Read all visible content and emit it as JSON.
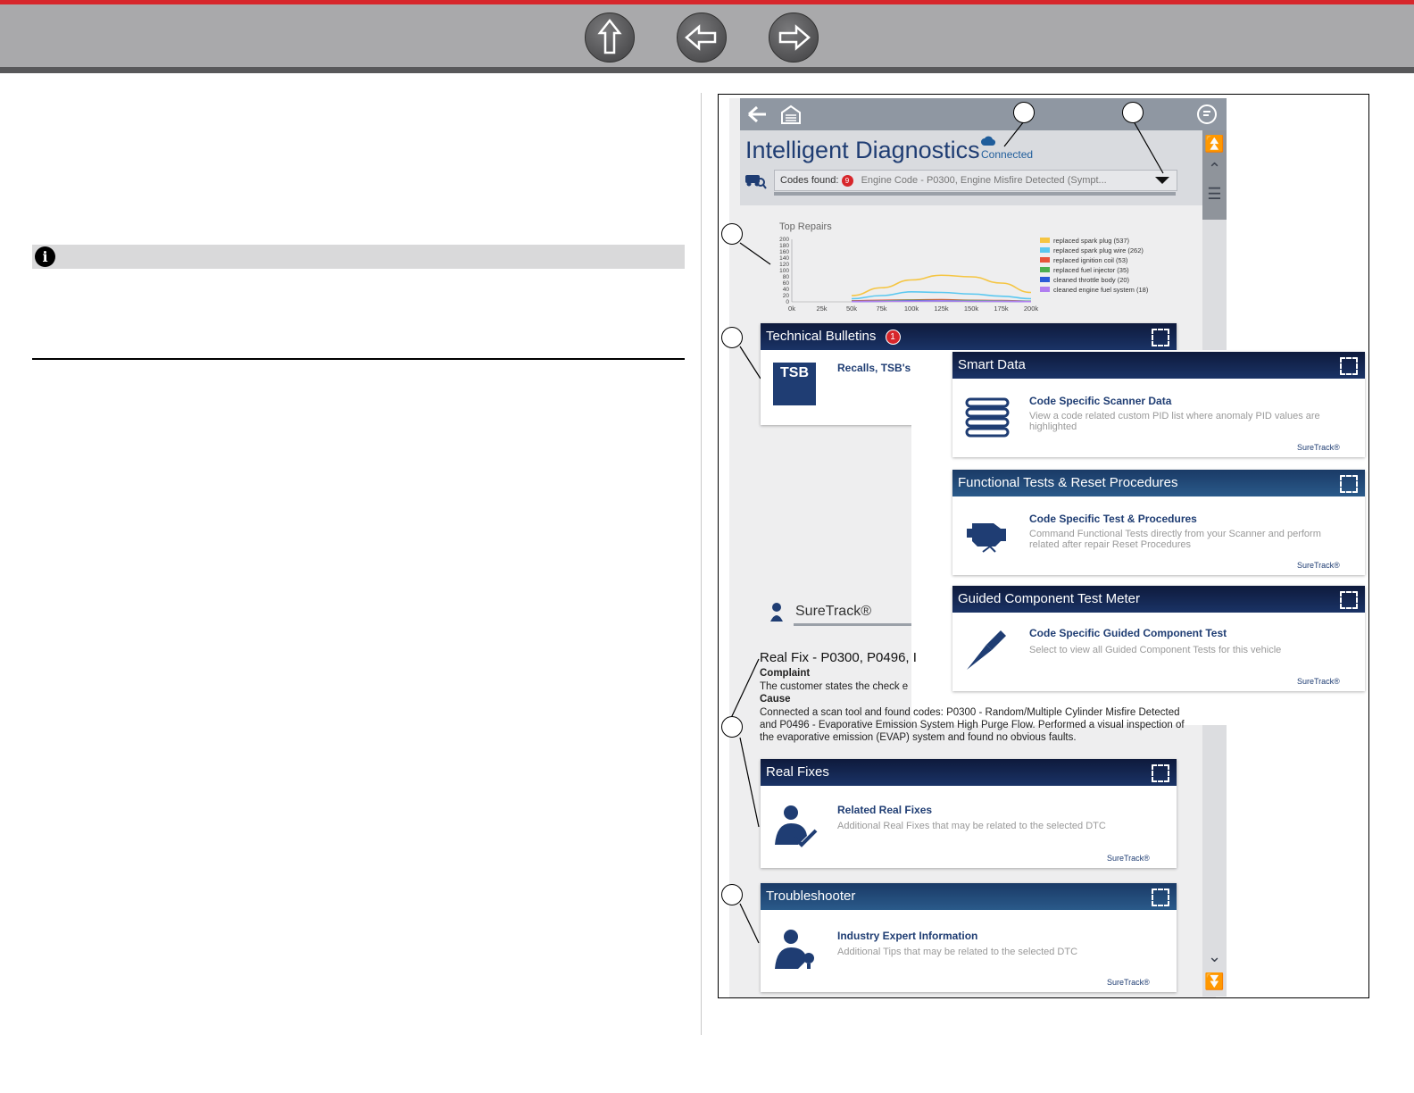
{
  "figure": {
    "app": {
      "title": "Intelligent Diagnostics",
      "connection_status": "Connected",
      "codes_found_label": "Codes found:",
      "codes_found_count": "9",
      "selected_code": "Engine Code - P0300, Engine Misfire Detected (Sympt..."
    },
    "top_repairs": {
      "title": "Top Repairs",
      "chart_data": {
        "type": "line",
        "title": "Top Repairs",
        "x": [
          "0k",
          "25k",
          "50k",
          "75k",
          "100k",
          "125k",
          "150k",
          "175k",
          "200k"
        ],
        "ylim": [
          0,
          200
        ],
        "y_ticks": [
          "200",
          "180",
          "160",
          "140",
          "120",
          "100",
          "80",
          "60",
          "40",
          "20",
          "0"
        ],
        "x_ticks": [
          "0k",
          "25k",
          "50k",
          "75k",
          "100k",
          "125k",
          "150k",
          "175k",
          "200k"
        ],
        "series": [
          {
            "name": "replaced spark plug (537)",
            "color": "#f5c542",
            "values": [
              null,
              null,
              20,
              45,
              70,
              85,
              80,
              60,
              30
            ]
          },
          {
            "name": "replaced spark plug wire (262)",
            "color": "#5bc8f0",
            "values": [
              null,
              null,
              10,
              20,
              32,
              30,
              25,
              18,
              10
            ]
          },
          {
            "name": "replaced ignition coil (53)",
            "color": "#e8543c",
            "values": [
              null,
              null,
              3,
              5,
              6,
              7,
              5,
              4,
              2
            ]
          },
          {
            "name": "replaced fuel injector (35)",
            "color": "#4caf50",
            "values": [
              null,
              null,
              2,
              3,
              5,
              4,
              4,
              3,
              2
            ]
          },
          {
            "name": "cleaned throttle body (20)",
            "color": "#2a5bd7",
            "values": [
              null,
              null,
              1,
              2,
              3,
              3,
              2,
              2,
              1
            ]
          },
          {
            "name": "cleaned engine fuel system (18)",
            "color": "#b07ef0",
            "values": [
              null,
              null,
              1,
              2,
              2,
              3,
              2,
              2,
              1
            ]
          }
        ]
      }
    },
    "technical_bulletins": {
      "title": "Technical Bulletins",
      "badge": "1",
      "icon_text": "TSB",
      "link": "Recalls, TSB's"
    },
    "smart_data": {
      "title": "Smart Data",
      "link": "Code Specific Scanner Data",
      "desc": "View a code related custom PID list where anomaly PID values are highlighted",
      "footer": "SureTrack®"
    },
    "functional_tests": {
      "title": "Functional Tests & Reset Procedures",
      "link": "Code Specific Test & Procedures",
      "desc": "Command Functional Tests directly from your Scanner and perform related after repair Reset Procedures",
      "footer": "SureTrack®"
    },
    "guided_test": {
      "title": "Guided Component Test Meter",
      "link": "Code Specific Guided Component Test",
      "desc": "Select to view all Guided Component Tests for this vehicle",
      "footer": "SureTrack®"
    },
    "suretrack": {
      "label": "SureTrack®",
      "fix_title": "Real Fix - P0300, P0496, I",
      "complaint_label": "Complaint",
      "complaint_text": "The customer states the check e",
      "cause_label": "Cause",
      "cause_line1": "Connected a scan tool and found codes: P0300 - Random/Multiple Cylinder Misfire Detected",
      "cause_line2": "and P0496 - Evaporative Emission System High Purge Flow. Performed a visual inspection of",
      "cause_line3": "the evaporative emission (EVAP) system and found no obvious faults."
    },
    "real_fixes": {
      "title": "Real Fixes",
      "link": "Related Real Fixes",
      "desc": "Additional Real Fixes that may be related to the selected DTC",
      "footer": "SureTrack®"
    },
    "troubleshooter": {
      "title": "Troubleshooter",
      "link": "Industry Expert Information",
      "desc": "Additional Tips that may be related to the selected DTC",
      "footer": "SureTrack®"
    }
  }
}
